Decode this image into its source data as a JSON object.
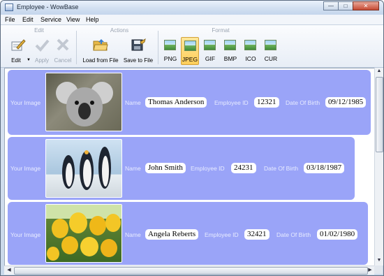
{
  "window": {
    "title": "Employee - WowBase"
  },
  "menu": [
    "File",
    "Edit",
    "Service",
    "View",
    "Help"
  ],
  "toolbar": {
    "groups": {
      "edit": "Edit",
      "actions": "Actions",
      "format": "Format"
    },
    "edit_label": "Edit",
    "apply_label": "Apply",
    "cancel_label": "Cancel",
    "load_label": "Load from File",
    "save_label": "Save to File",
    "formats": [
      "PNG",
      "JPEG",
      "GIF",
      "BMP",
      "ICO",
      "CUR"
    ],
    "active_format": "JPEG"
  },
  "labels": {
    "image": "Your Image",
    "name": "Name",
    "employee_id": "Employee ID",
    "dob": "Date Of Birth"
  },
  "records": [
    {
      "name": "Thomas Anderson",
      "employee_id": "12321",
      "dob": "09/12/1985",
      "photo": "koala"
    },
    {
      "name": "John Smith",
      "employee_id": "24231",
      "dob": "03/18/1987",
      "photo": "penguins"
    },
    {
      "name": "Angela Reberts",
      "employee_id": "32421",
      "dob": "01/02/1980",
      "photo": "tulips"
    }
  ],
  "colors": {
    "record_bg": "#9aa4f8",
    "accent": "#ffcd59"
  }
}
